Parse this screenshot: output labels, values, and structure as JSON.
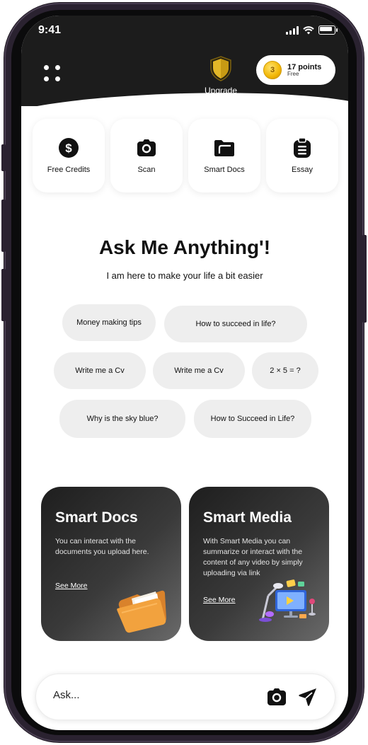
{
  "status_bar": {
    "time": "9:41"
  },
  "header": {
    "upgrade_label": "Upgrade",
    "points_label": "17 points",
    "plan_label": "Free",
    "coin_symbol": "3"
  },
  "quick_actions": [
    {
      "label": "Free Credits",
      "icon": "dollar-icon"
    },
    {
      "label": "Scan",
      "icon": "camera-icon"
    },
    {
      "label": "Smart Docs",
      "icon": "folder-icon"
    },
    {
      "label": "Essay",
      "icon": "clipboard-icon"
    }
  ],
  "hero": {
    "title": "Ask Me Anything'!",
    "subtitle": "I am here to make your life a bit easier"
  },
  "suggestions": [
    "Money making tips",
    "How to succeed in life?",
    "Write me a Cv",
    "Write me a Cv",
    "2 × 5 = ?",
    "Why is the sky blue?",
    "How to Succeed in Life?"
  ],
  "cards": {
    "docs": {
      "title": "Smart Docs",
      "text": "You can interact with the documents you upload here.",
      "link": "See More"
    },
    "media": {
      "title": "Smart Media",
      "text": "With Smart Media you can summarize or interact with the content of any video by simply uploading via link",
      "link": "See More"
    }
  },
  "ask": {
    "placeholder": "Ask..."
  },
  "colors": {
    "header_bg": "#1c1c1c",
    "chip_bg": "#eeeeee",
    "accent_gold": "#f2b705"
  }
}
